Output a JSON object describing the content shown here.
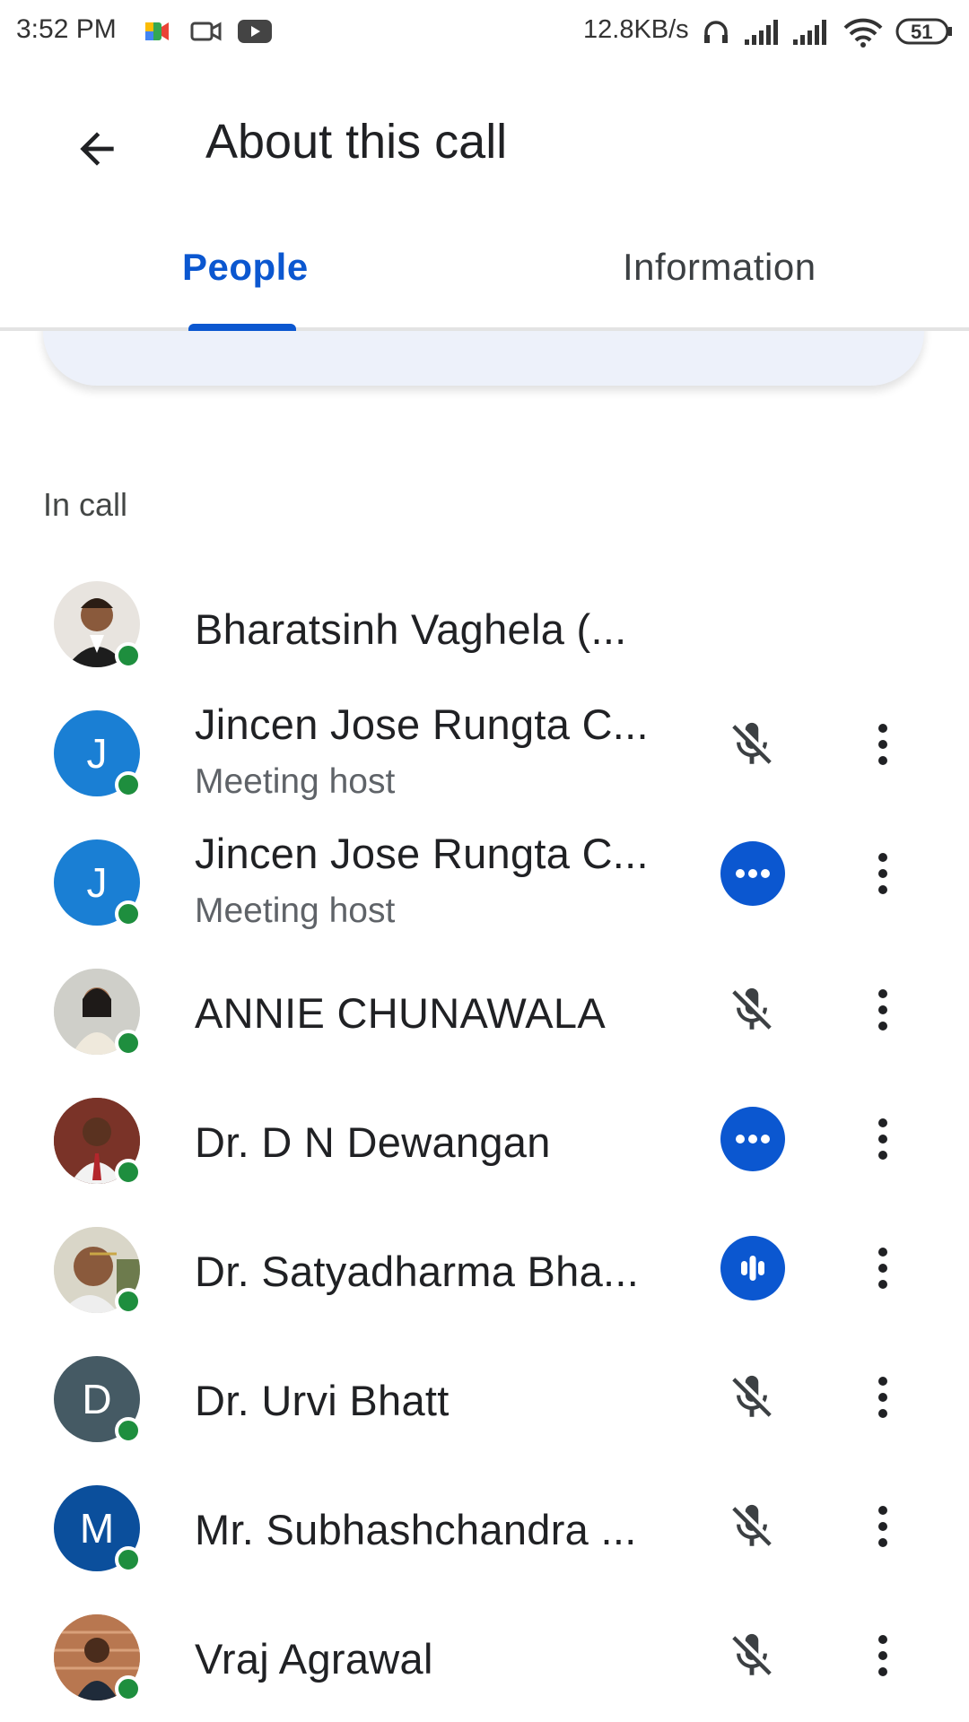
{
  "status_bar": {
    "time": "3:52 PM",
    "speed": "12.8KB/s",
    "battery": "51"
  },
  "app_bar": {
    "title": "About this call",
    "back_icon": "arrow-back-icon"
  },
  "tabs": [
    {
      "label": "People",
      "selected": true
    },
    {
      "label": "Information",
      "selected": false
    }
  ],
  "section": {
    "label": "In call"
  },
  "participants": [
    {
      "name": "Bharatsinh Vaghela (...",
      "subtitle": "",
      "avatar": "photo",
      "status": "none"
    },
    {
      "name": "Jincen Jose Rungta C...",
      "subtitle": "Meeting host",
      "avatar": "J",
      "status": "muted"
    },
    {
      "name": "Jincen Jose Rungta C...",
      "subtitle": "Meeting host",
      "avatar": "J",
      "status": "more-options"
    },
    {
      "name": "ANNIE CHUNAWALA",
      "subtitle": "",
      "avatar": "photo",
      "status": "muted"
    },
    {
      "name": "Dr. D N Dewangan",
      "subtitle": "",
      "avatar": "photo",
      "status": "more-options"
    },
    {
      "name": "Dr. Satyadharma Bha...",
      "subtitle": "",
      "avatar": "photo",
      "status": "speaking"
    },
    {
      "name": "Dr. Urvi Bhatt",
      "subtitle": "",
      "avatar": "D",
      "status": "muted"
    },
    {
      "name": "Mr. Subhashchandra ...",
      "subtitle": "",
      "avatar": "M",
      "status": "muted"
    },
    {
      "name": "Vraj Agrawal",
      "subtitle": "",
      "avatar": "photo",
      "status": "muted"
    }
  ],
  "colors": {
    "accent": "#0b57d0",
    "online": "#1e8e3e",
    "avatar_j": "#1a7fd4",
    "avatar_d": "#455a64",
    "avatar_m": "#0b4f9c"
  }
}
